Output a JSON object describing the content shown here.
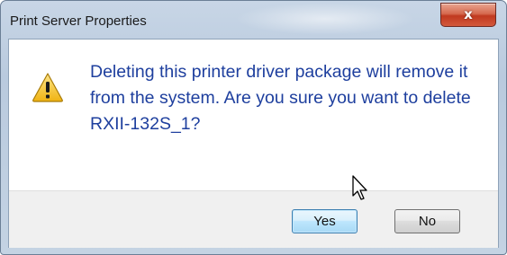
{
  "window": {
    "title": "Print Server Properties",
    "close_glyph": "x",
    "close_icon": "close-icon"
  },
  "dialog": {
    "icon": "warning-icon",
    "message": "Deleting this printer driver package will remove it from the system. Are you sure you want to delete RXII-132S_1?",
    "buttons": {
      "yes_label": "Yes",
      "no_label": "No"
    }
  },
  "colors": {
    "message_text": "#1e3f9e",
    "close_button": "#c0391f",
    "warning_fill": "#f5c323"
  }
}
